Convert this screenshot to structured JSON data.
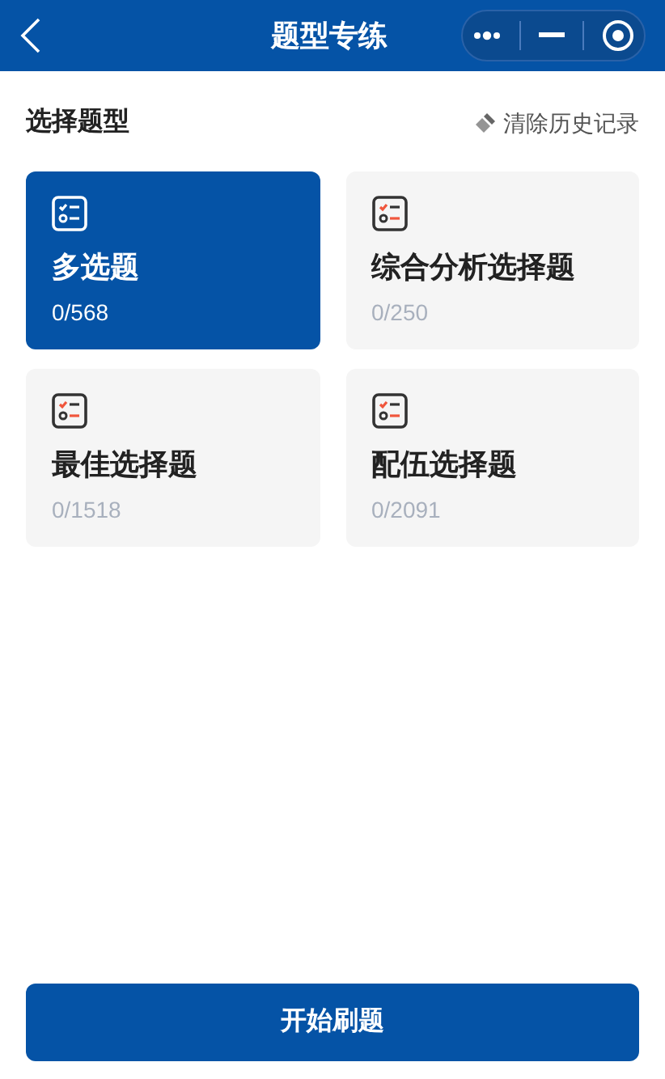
{
  "header": {
    "title": "题型专练"
  },
  "section": {
    "title": "选择题型",
    "clear_label": "清除历史记录"
  },
  "types": [
    {
      "name": "多选题",
      "progress": "0/568",
      "selected": true
    },
    {
      "name": "综合分析选择题",
      "progress": "0/250",
      "selected": false
    },
    {
      "name": "最佳选择题",
      "progress": "0/1518",
      "selected": false
    },
    {
      "name": "配伍选择题",
      "progress": "0/2091",
      "selected": false
    }
  ],
  "start_button": "开始刷题"
}
